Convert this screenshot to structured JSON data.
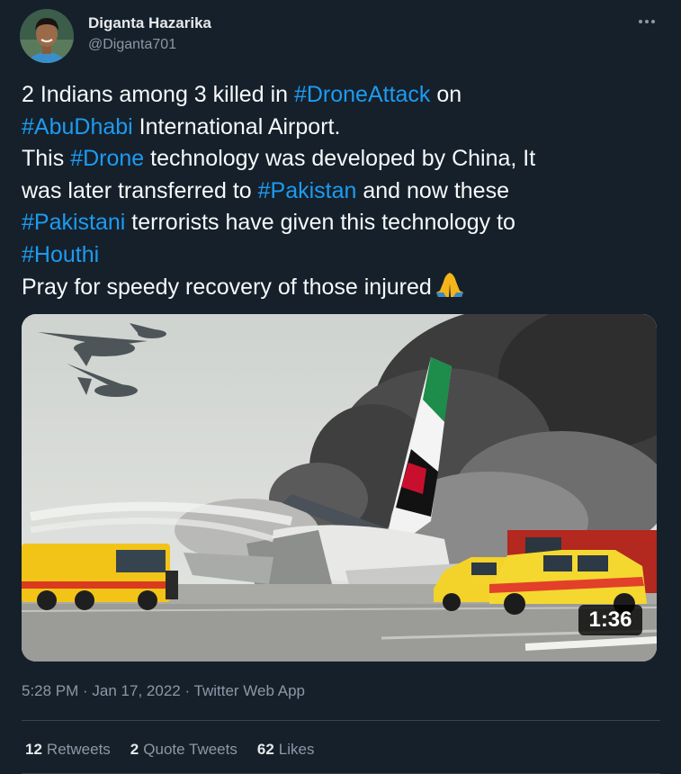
{
  "author": {
    "name": "Diganta Hazarika",
    "handle": "@Diganta701"
  },
  "icons": {
    "more": "more-horizontal-icon",
    "emoji": "folded-hands-icon"
  },
  "tweet": {
    "lines": [
      [
        {
          "t": "2 Indians among 3 killed in "
        },
        {
          "t": "#DroneAttack",
          "tag": true
        },
        {
          "t": " on"
        }
      ],
      [
        {
          "t": "#AbuDhabi",
          "tag": true
        },
        {
          "t": " International Airport."
        }
      ],
      [
        {
          "t": "This "
        },
        {
          "t": "#Drone",
          "tag": true
        },
        {
          "t": " technology was developed by China, It"
        }
      ],
      [
        {
          "t": "was later transferred to "
        },
        {
          "t": "#Pakistan",
          "tag": true
        },
        {
          "t": " and now these"
        }
      ],
      [
        {
          "t": "#Pakistani",
          "tag": true
        },
        {
          "t": " terrorists have given this technology to"
        }
      ],
      [
        {
          "t": "#Houthi",
          "tag": true
        }
      ],
      [
        {
          "t": "Pray for speedy recovery of those injured"
        },
        {
          "emoji": "pray"
        }
      ]
    ]
  },
  "media": {
    "duration": "1:36"
  },
  "meta": {
    "timestamp": "5:28 PM · Jan 17, 2022 · Twitter Web App"
  },
  "stats": [
    {
      "count": "12",
      "label": "Retweets"
    },
    {
      "count": "2",
      "label": "Quote Tweets"
    },
    {
      "count": "62",
      "label": "Likes"
    }
  ],
  "colors": {
    "background": "#15202b",
    "text": "#f7f9f9",
    "secondary": "#8b98a5",
    "link": "#1d9bf0",
    "divider": "#38444d"
  }
}
